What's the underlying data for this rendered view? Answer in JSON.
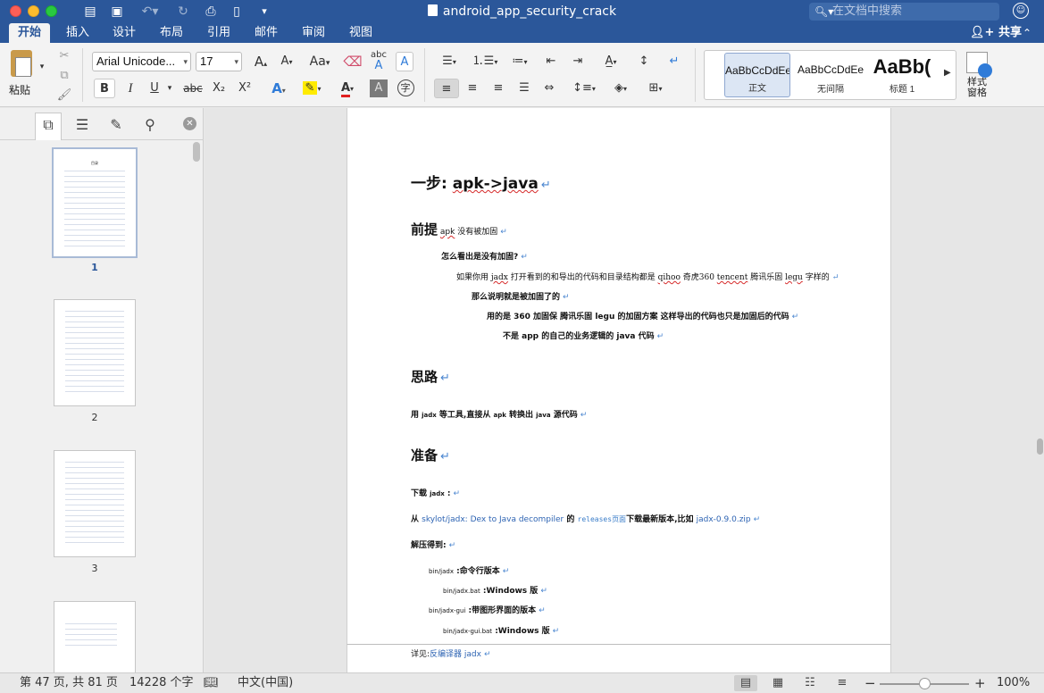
{
  "window": {
    "title": "android_app_security_crack",
    "search_placeholder": "在文档中搜索"
  },
  "ribbon_tabs": [
    "开始",
    "插入",
    "设计",
    "布局",
    "引用",
    "邮件",
    "审阅",
    "视图"
  ],
  "share_label": "共享",
  "ribbon": {
    "paste_label": "粘贴",
    "font_name": "Arial Unicode...",
    "font_size": "17",
    "grow_font": "A",
    "shrink_font": "A",
    "change_case": "Aa",
    "abc_label": "abc",
    "bold": "B",
    "italic": "I",
    "underline": "U",
    "strikethrough": "abc",
    "subscript": "X₂",
    "superscript": "X²",
    "phonetic": "字",
    "styles": [
      {
        "sample": "AaBbCcDdEe",
        "name": "正文",
        "selected": true
      },
      {
        "sample": "AaBbCcDdEe",
        "name": "无间隔",
        "selected": false
      },
      {
        "sample": "AaBb(",
        "name": "标题 1",
        "selected": false
      }
    ],
    "styles_pane_label": "样式\n窗格"
  },
  "nav": {
    "thumbnails": [
      {
        "num": "1",
        "title": "目录",
        "selected": true
      },
      {
        "num": "2",
        "selected": false
      },
      {
        "num": "3",
        "selected": false
      }
    ]
  },
  "document": {
    "l1": "一步: apk->java",
    "l1_wavy": "apk->java",
    "l2_h": "前提",
    "l2_rest": "apk 没有被加固",
    "l3": "怎么看出是没有加固?",
    "l4a": "如果你用 ",
    "l4_jadx": "jadx",
    "l4b": " 打开看到的和导出的代码和目录结构都是 ",
    "l4_qihoo": "qihoo",
    "l4c": " 奇虎360 ",
    "l4_tencent": "tencent",
    "l4d": " 腾讯乐固 ",
    "l4_legu": "legu",
    "l4e": " 字样的",
    "l5": "那么说明就是被加固了的",
    "l6": "用的是 360 加固保 腾讯乐固 legu 的加固方案 这样导出的代码也只是加固后的代码",
    "l7": "不是 app 的自己的业务逻辑的 java 代码",
    "h_silu": "思路",
    "l8a": "用 ",
    "l8_jadx": "jadx",
    "l8b": " 等工具,直接从 ",
    "l8_apk": "apk",
    "l8c": " 转换出 ",
    "l8_java": "java",
    "l8d": " 源代码",
    "h_zhunbei": "准备",
    "l9a": "下载 ",
    "l9_jadx": "jadx",
    "l9b": " :",
    "l10a": "从 ",
    "l10_link": "skylot/jadx: Dex to Java decompiler",
    "l10b": " 的 ",
    "l10_releases": "releases页面",
    "l10c": "下载最新版本,比如 ",
    "l10_zip": "jadx-0.9.0.zip",
    "l11": "解压得到:",
    "l12a": "bin/jadx",
    "l12b": " :命令行版本",
    "l13a": "bin/jadx.bat",
    "l13b": " :Windows 版",
    "l14a": "bin/jadx-gui",
    "l14b": " :带图形界面的版本",
    "l15a": "bin/jadx-gui.bat",
    "l15b": " :Windows 版",
    "l16a": "详见:",
    "l16_link": "反编译器 jadx",
    "para_mark": "↵"
  },
  "status": {
    "page": "第 47 页, 共 81 页",
    "words": "14228 个字",
    "language": "中文(中国)",
    "zoom": "100%",
    "zoom_level": 0.5
  },
  "colors": {
    "accent": "#2b579a",
    "link": "#2e64b3",
    "para_mark": "#4a86d0"
  }
}
